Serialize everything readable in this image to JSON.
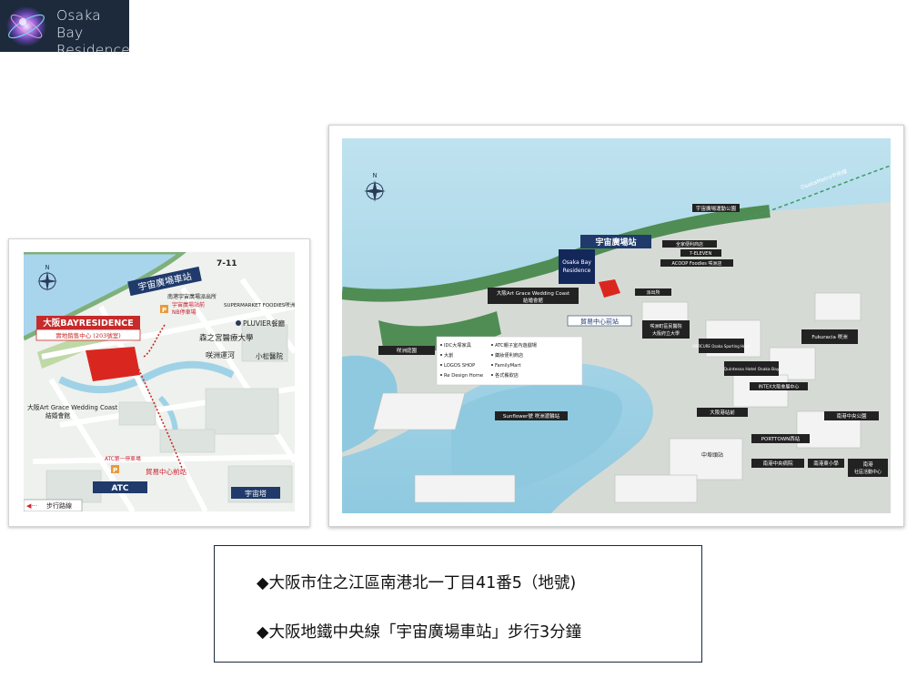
{
  "logo": {
    "line1": "Osaka Bay",
    "line2": "Residence"
  },
  "small_map": {
    "station_label": "宇宙廣場車站",
    "seven_eleven": "7-11",
    "police_label": "南港宇宙廣場派出所",
    "parking_label_line1": "宇宙廣場站前",
    "parking_label_line2": "NB停車場",
    "supermarket": "SUPERMARKET FOODIES咲洲店",
    "residence_title": "大阪BAYRESIDENCE",
    "residence_sub": "實地銷售中心 (203號室)",
    "pluvier": "PLUVIER餐廳",
    "university": "森之宮醫療大學",
    "canal": "咲洲運河",
    "clinic": "小松醫院",
    "wedding_line1": "大阪Art Grace Wedding Coast",
    "wedding_line2": "結婚會館",
    "atc_parking": "ATC第一停車場",
    "trade_station": "貿易中心前站",
    "atc": "ATC",
    "tower": "宇宙塔",
    "legend": "步行路線"
  },
  "large_map": {
    "metro_line": "OsakaMetro中央線",
    "top_building": "宇宙廣場運動公園",
    "station": "宇宙廣場站",
    "logo_line1": "Osaka Bay",
    "logo_line2": "Residence",
    "family_mart": "全家便利商店",
    "supermarket": "SUPERMARKET FOODIES",
    "seven_eleven": "7-ELEVEN",
    "acoop": "ACOOP Foodies 咲洲店",
    "wedding_line1": "大阪Art Grace Wedding Coast",
    "wedding_line2": "結婚會館",
    "police": "派出所",
    "trade_station": "貿易中心前站",
    "kashima": "咲洲庭園",
    "university_line1": "咲洲町區民醫院",
    "university_line2": "大阪府立大學",
    "wtc": "大阪南港WTC",
    "mercure": "MERCURE Osaka Sporting Hotel",
    "fukuracia": "Fukuracia 咲洲",
    "park": "大阪咲洲公園",
    "ascot": "Quintessa Hotel Osaka Bay",
    "intex": "INTEX大阪會展中心",
    "port_station": "大阪港站前",
    "sunflower": "Sunflower號 咲洲渡輪站",
    "port_town": "PORTTOWN西站",
    "medical": "南港中央病院",
    "nanko_park": "南港中央公園",
    "school": "南港東小學",
    "nursery_line1": "南港",
    "nursery_line2": "社區活動中心",
    "nakafuto": "中埠頭站",
    "stores": [
      "IDC大塚家具",
      "大創",
      "LOGOS SHOP",
      "Re Design Home",
      "ATC親子室內遊戲場",
      "藥妝便利商店",
      "FamilyMart",
      "各式餐飲店"
    ]
  },
  "address": {
    "line1": "◆大阪市住之江區南港北一丁目41番5（地號)",
    "line2": "◆大阪地鐵中央線「宇宙廣場車站」步行3分鐘"
  }
}
